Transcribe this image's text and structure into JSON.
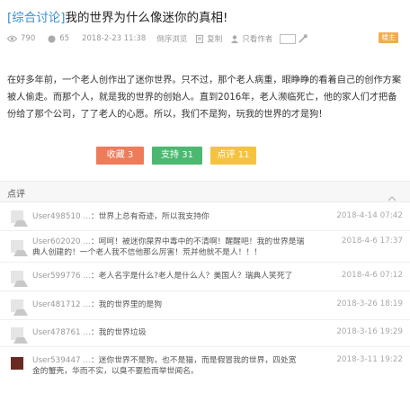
{
  "post": {
    "category": "[综合讨论]",
    "title": "我的世界为什么像迷你的真相!",
    "views": "790",
    "replies": "65",
    "datetime": "2018-2-23 11:38",
    "mode": "倒序浏览",
    "copy_label": "复制",
    "author_only_label": "只看作者",
    "badge": "楼主",
    "content": "在好多年前，一个老人创作出了迷你世界。只不过，那个老人病重，眼睁睁的看着自己的创作方案被人偷走。而那个人，就是我的世界的创始人。直到2016年，老人濒临死亡，他的家人们才把备份给了那个公司，了了老人的心愿。所以，我们不是狗，玩我的世界的才是狗!"
  },
  "actions": {
    "collect": "收藏 3",
    "support": "支持 31",
    "reject": "点评 11"
  },
  "comments_header": "点评",
  "comments": [
    {
      "user": "User498510 ...",
      "text": "：世界上总有奇迹，所以我支持你",
      "time": "2018-4-14 07:42"
    },
    {
      "user": "User602020 ...",
      "text": "：呵呵！被迷你屎界中毒中的不清啊！醒醒吧！我的世界是瑞典人创建的！一个老人我不信他那么厉害！荒并他就不是人！！！",
      "time": "2018-4-6 17:37"
    },
    {
      "user": "User599776 ...",
      "text": "：老人名字是什么?老人是什么人？美国人？瑞典人笑死了",
      "time": "2018-4-6 07:12"
    },
    {
      "user": "User481712 ...",
      "text": "：我的世界里的是狗",
      "time": "2018-3-26 18:19"
    },
    {
      "user": "User478761 ...",
      "text": "：我的世界垃圾",
      "time": "2018-3-16 19:29"
    },
    {
      "user": "User539447 ...",
      "text": "：迷你世界不是狗，也不是猫，而是假冒我的世界，四处宽金的蟹壳，华而不实，以臭不要脸而举世闻名。",
      "time": "2018-3-11 19:22"
    }
  ],
  "icons": {
    "views": "eye-icon",
    "replies": "comment-icon",
    "copy": "copy-icon",
    "author": "person-icon",
    "settings": "wrench-icon",
    "collapse": "chevron-up-icon"
  },
  "colors": {
    "category": "#3a8fd8",
    "collect": "#ed7d5a",
    "support": "#4cb870",
    "reject": "#f5c33f",
    "badge": "#f0ad4e"
  }
}
